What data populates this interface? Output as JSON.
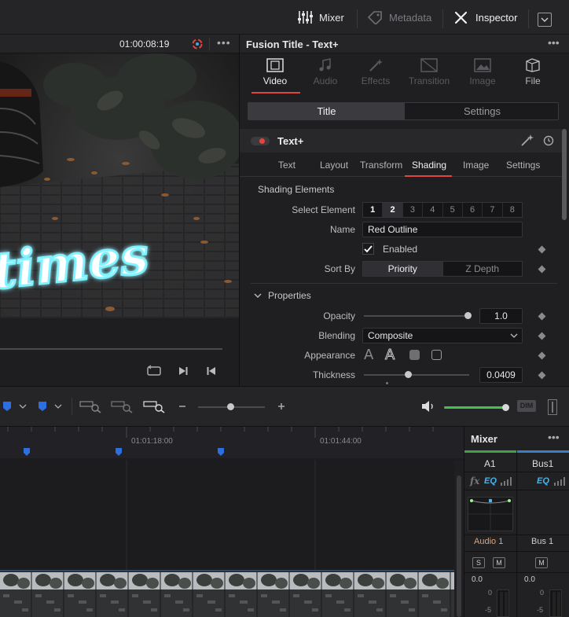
{
  "topbar": {
    "mixer_label": "Mixer",
    "metadata_label": "Metadata",
    "inspector_label": "Inspector"
  },
  "viewer": {
    "timecode": "01:00:08:19",
    "overlay_text": "times"
  },
  "inspector": {
    "title": "Fusion Title - Text+",
    "tabs": [
      {
        "label": "Video",
        "icon": "film-icon",
        "active": true
      },
      {
        "label": "Audio",
        "icon": "music-note-icon",
        "active": false
      },
      {
        "label": "Effects",
        "icon": "magic-wand-icon",
        "active": false
      },
      {
        "label": "Transition",
        "icon": "transition-icon",
        "active": false
      },
      {
        "label": "Image",
        "icon": "image-icon",
        "active": false
      },
      {
        "label": "File",
        "icon": "file-icon",
        "active": false
      }
    ],
    "segment": {
      "left": "Title",
      "right": "Settings"
    },
    "tool_name": "Text+",
    "subtabs": [
      "Text",
      "Layout",
      "Transform",
      "Shading",
      "Image",
      "Settings"
    ],
    "active_subtab": "Shading",
    "section_label": "Shading Elements",
    "select_element_label": "Select Element",
    "elements": [
      "1",
      "2",
      "3",
      "4",
      "5",
      "6",
      "7",
      "8"
    ],
    "selected_element": "2",
    "name_label": "Name",
    "name_value": "Red Outline",
    "enabled_label": "Enabled",
    "enabled": true,
    "sort_by_label": "Sort By",
    "sort_by_options": [
      "Priority",
      "Z Depth"
    ],
    "sort_by_selected": "Priority",
    "properties_label": "Properties",
    "opacity_label": "Opacity",
    "opacity_value": "1.0",
    "blending_label": "Blending",
    "blending_value": "Composite",
    "appearance_label": "Appearance",
    "thickness_label": "Thickness",
    "thickness_value": "0.0409"
  },
  "timeline": {
    "ruler_marks": [
      "01:01:18:00",
      "01:01:44:00"
    ],
    "dim_label": "DIM"
  },
  "mixer": {
    "title": "Mixer",
    "channels": [
      {
        "name": "A1",
        "eq": "EQ",
        "track": "Audio 1",
        "level": "0.0",
        "buttons": [
          "S",
          "M"
        ],
        "color": "#3fa14a"
      },
      {
        "name": "Bus1",
        "eq": "EQ",
        "track": "Bus 1",
        "level": "0.0",
        "buttons": [
          "M"
        ],
        "color": "#3a7fc4"
      }
    ],
    "fx_label": "fx",
    "scale": [
      "0",
      "-5"
    ]
  },
  "colors": {
    "accent_red": "#e0463d",
    "glow_cyan": "#7ff3ff",
    "marker_blue": "#2d6fe0",
    "level_green": "#44c24b"
  }
}
